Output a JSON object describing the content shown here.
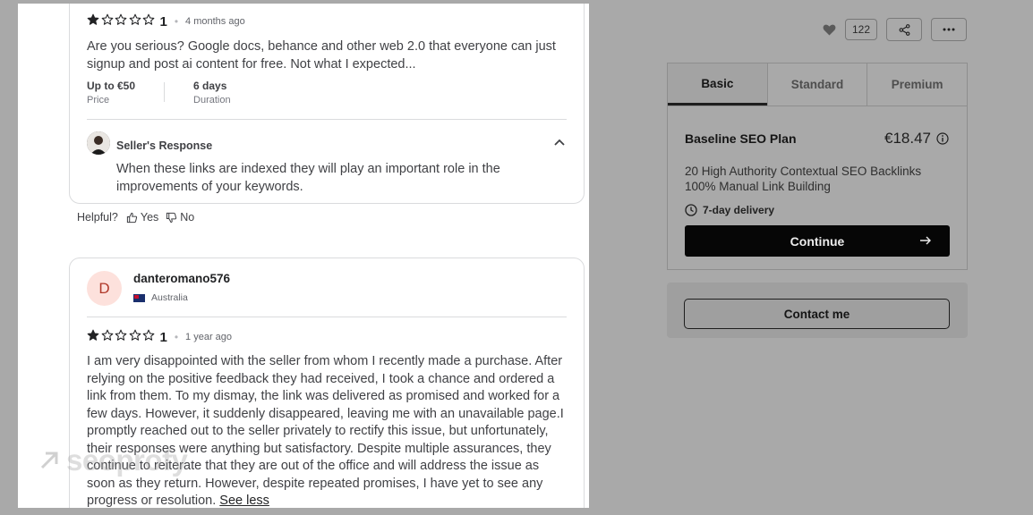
{
  "review1": {
    "rating": "1",
    "stars_filled": 1,
    "stars_total": 5,
    "time_ago": "4 months ago",
    "text": "Are you serious? Google docs, behance and other web 2.0 that everyone can just signup and post ai content for free. Not what I expected...",
    "price_value": "Up to €50",
    "price_label": "Price",
    "duration_value": "6 days",
    "duration_label": "Duration",
    "seller_response_title": "Seller's Response",
    "seller_response_text": "When these links are indexed they will play an important role in the improvements of your keywords."
  },
  "helpful": {
    "label": "Helpful?",
    "yes": "Yes",
    "no": "No"
  },
  "review2": {
    "avatar_letter": "D",
    "username": "danteromano576",
    "country": "Australia",
    "rating": "1",
    "stars_filled": 1,
    "stars_total": 5,
    "time_ago": "1 year ago",
    "text": "I am very disappointed with the seller from whom I recently made a purchase. After relying on the positive feedback they had received, I took a chance and ordered a link from them. To my dismay, the link was delivered as promised and worked for a few days. However, it suddenly disappeared, leaving me with an unavailable page.I promptly reached out to the seller privately to rectify this issue, but unfortunately, their responses were anything but satisfactory. Despite multiple assurances, they continue to reiterate that they are out of the office and will address the issue as soon as they return. However, despite repeated promises, I have yet to see any progress or resolution.",
    "see_less": "See less"
  },
  "watermark": "seoprofy",
  "likes_count": "122",
  "package": {
    "tabs": [
      "Basic",
      "Standard",
      "Premium"
    ],
    "active_tab": "Basic",
    "plan_name": "Baseline SEO Plan",
    "price": "€18.47",
    "description_line1": "20 High Authority Contextual SEO Backlinks",
    "description_line2": "100% Manual Link Building",
    "delivery": "7-day delivery",
    "continue_label": "Continue"
  },
  "contact_label": "Contact me",
  "colors": {
    "overlay": "#a9a9a9",
    "button_dark": "#060606",
    "star": "#222325",
    "avatar_bg": "#fde1dc"
  }
}
